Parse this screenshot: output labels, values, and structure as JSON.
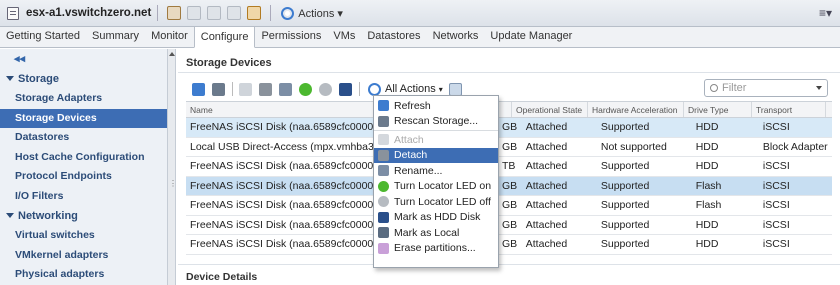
{
  "header": {
    "title": "esx-a1.vswitchzero.net",
    "actions_label": "Actions ▾"
  },
  "tabs": [
    {
      "label": "Getting Started"
    },
    {
      "label": "Summary"
    },
    {
      "label": "Monitor"
    },
    {
      "label": "Configure"
    },
    {
      "label": "Permissions"
    },
    {
      "label": "VMs"
    },
    {
      "label": "Datastores"
    },
    {
      "label": "Networks"
    },
    {
      "label": "Update Manager"
    }
  ],
  "nav": {
    "collapse": "◂◂",
    "storage_group": "Storage",
    "storage_items": [
      "Storage Adapters",
      "Storage Devices",
      "Datastores",
      "Host Cache Configuration",
      "Protocol Endpoints",
      "I/O Filters"
    ],
    "networking_group": "Networking",
    "networking_items": [
      "Virtual switches",
      "VMkernel adapters",
      "Physical adapters"
    ]
  },
  "main": {
    "section_title": "Storage Devices",
    "all_actions": "All Actions",
    "filter_placeholder": "Filter",
    "columns": [
      "Name",
      "Operational State",
      "Hardware Acceleration",
      "Drive Type",
      "Transport"
    ],
    "rows": [
      {
        "name": "FreeNAS iSCSI Disk (naa.6589cfc00000...",
        "cap": "GB",
        "op": "Attached",
        "hw": "Supported",
        "dt": "HDD",
        "tr": "iSCSI"
      },
      {
        "name": "Local USB Direct-Access (mpx.vmhba32...",
        "cap": "GB",
        "op": "Attached",
        "hw": "Not supported",
        "dt": "HDD",
        "tr": "Block Adapter"
      },
      {
        "name": "FreeNAS iSCSI Disk (naa.6589cfc00000...",
        "cap": "TB",
        "op": "Attached",
        "hw": "Supported",
        "dt": "HDD",
        "tr": "iSCSI"
      },
      {
        "name": "FreeNAS iSCSI Disk (naa.6589cfc00000...",
        "cap": "GB",
        "op": "Attached",
        "hw": "Supported",
        "dt": "Flash",
        "tr": "iSCSI"
      },
      {
        "name": "FreeNAS iSCSI Disk (naa.6589cfc00000...",
        "cap": "GB",
        "op": "Attached",
        "hw": "Supported",
        "dt": "Flash",
        "tr": "iSCSI"
      },
      {
        "name": "FreeNAS iSCSI Disk (naa.6589cfc00000...",
        "cap": "GB",
        "op": "Attached",
        "hw": "Supported",
        "dt": "HDD",
        "tr": "iSCSI"
      },
      {
        "name": "FreeNAS iSCSI Disk (naa.6589cfc00000...",
        "cap": "GB",
        "op": "Attached",
        "hw": "Supported",
        "dt": "HDD",
        "tr": "iSCSI"
      }
    ],
    "device_details": "Device Details"
  },
  "menu": {
    "items": [
      "Refresh",
      "Rescan Storage...",
      "Attach",
      "Detach",
      "Rename...",
      "Turn Locator LED on",
      "Turn Locator LED off",
      "Mark as HDD Disk",
      "Mark as Local",
      "Erase partitions..."
    ]
  }
}
